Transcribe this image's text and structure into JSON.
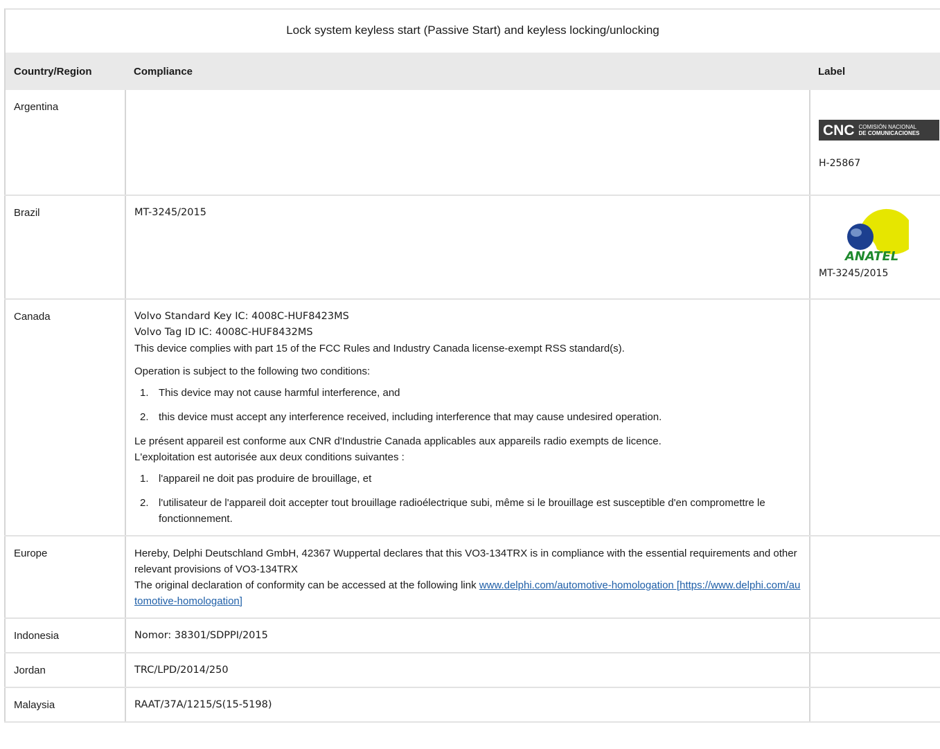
{
  "table": {
    "caption": "Lock system keyless start (Passive Start) and keyless locking/unlocking",
    "headers": {
      "country": "Country/Region",
      "compliance": "Compliance",
      "label": "Label"
    }
  },
  "rows": {
    "argentina": {
      "country": "Argentina",
      "logo_mark": "CNC",
      "logo_line1": "COMISIÓN NACIONAL",
      "logo_line2": "DE COMUNICACIONES",
      "label_code": "H-25867"
    },
    "brazil": {
      "country": "Brazil",
      "compliance": "MT-3245/2015",
      "logo_text": "ANATEL",
      "label_code": "MT-3245/2015"
    },
    "canada": {
      "country": "Canada",
      "line1": "Volvo Standard Key IC: 4008C-HUF8423MS",
      "line2": "Volvo Tag ID IC: 4008C-HUF8432MS",
      "line3": "This device complies with part 15 of the FCC Rules and Industry Canada license-exempt RSS standard(s).",
      "line4": "Operation is subject to the following two conditions:",
      "en_item1_num": "1.",
      "en_item1": "This device may not cause harmful interference, and",
      "en_item2_num": "2.",
      "en_item2": "this device must accept any interference received, including interference that may cause undesired operation.",
      "fr_line1": "Le présent appareil est conforme aux CNR d'Industrie Canada applicables aux appareils radio exempts de licence.",
      "fr_line2": "L'exploitation est autorisée aux deux conditions suivantes :",
      "fr_item1_num": "1.",
      "fr_item1": "l'appareil ne doit pas produire de brouillage, et",
      "fr_item2_num": "2.",
      "fr_item2": "l'utilisateur de l'appareil doit accepter tout brouillage radioélectrique subi, même si le brouillage est susceptible d'en compromettre le fonctionnement."
    },
    "europe": {
      "country": "Europe",
      "line1": "Hereby, Delphi Deutschland GmbH, 42367 Wuppertal declares that this VO3-134TRX is in compliance with the essential requirements and other relevant provisions of VO3-134TRX",
      "line2_prefix": "The original declaration of conformity can be accessed at the following link ",
      "link_text": "www.delphi.com/automotive-homologation [https://www.delphi.com/automotive-homologation]"
    },
    "indonesia": {
      "country": "Indonesia",
      "compliance": "Nomor: 38301/SDPPI/2015"
    },
    "jordan": {
      "country": "Jordan",
      "compliance": "TRC/LPD/2014/250"
    },
    "malaysia": {
      "country": "Malaysia",
      "compliance": "RAAT/37A/1215/S(15-5198)"
    }
  },
  "colors": {
    "header_bg": "#e9e9e9",
    "border": "#d6d6d6",
    "link": "#1f5fa8",
    "anatel_yellow": "#e6e600",
    "anatel_blue": "#1c3f8f",
    "anatel_green": "#1f8a2e"
  }
}
